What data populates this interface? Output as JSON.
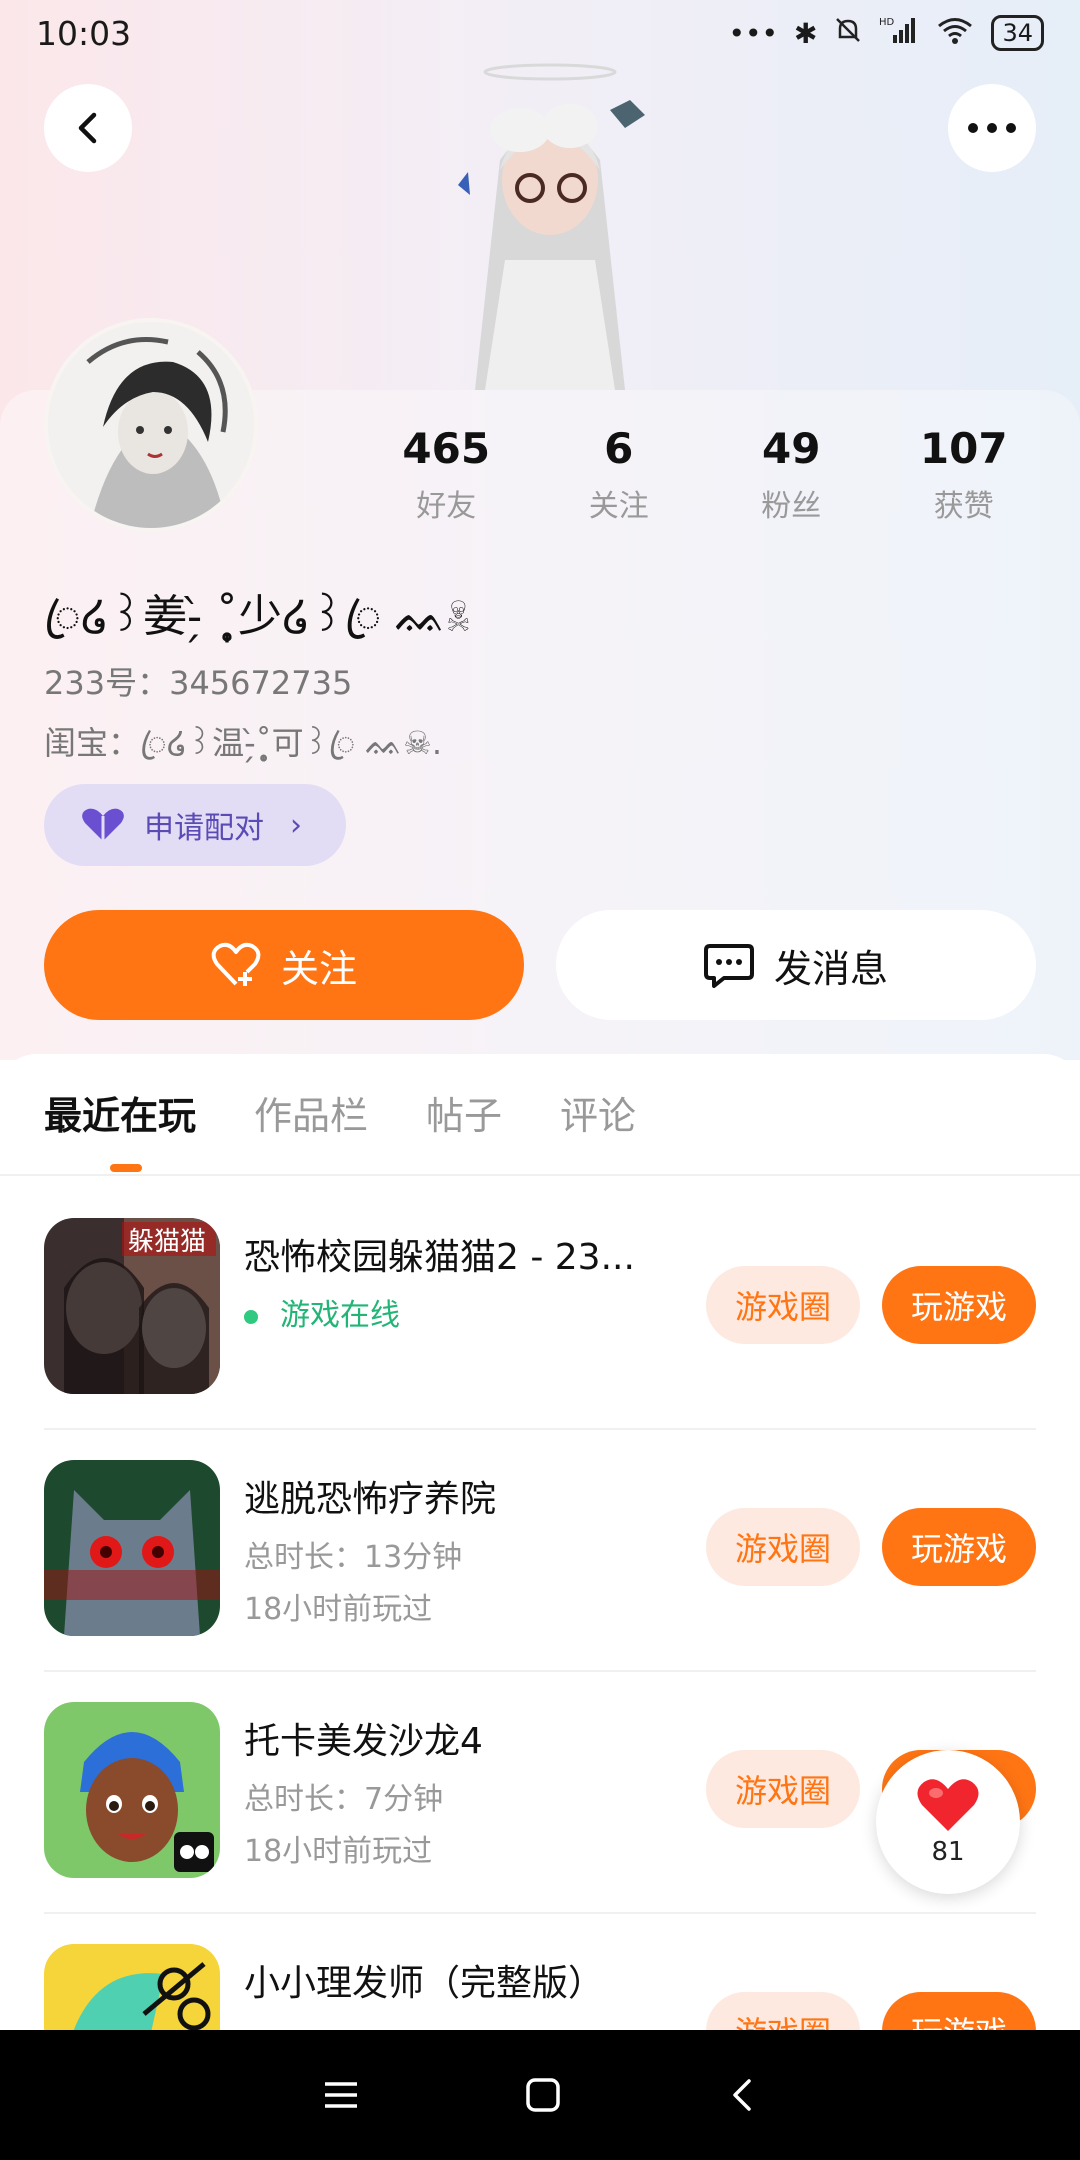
{
  "status_bar": {
    "time": "10:03",
    "battery": "34",
    "network": "HD"
  },
  "header": {
    "back_icon": "chevron-left-icon",
    "more_icon": "more-dots-icon"
  },
  "profile": {
    "stats": [
      {
        "value": "465",
        "label": "好友"
      },
      {
        "value": "6",
        "label": "关注"
      },
      {
        "value": "49",
        "label": "粉丝"
      },
      {
        "value": "107",
        "label": "获赞"
      }
    ],
    "username": "ꦿ໒꒱姜-̗̀ ˚̩̥̩̥少໒꒱ꦿ ᨐ☠",
    "uid": "233号：345672735",
    "bestie": "闺宝：ꦿ໒꒱温-̗̀˚̩̥̩̥可꒱ꦿ ᨐ☠.",
    "pair_button": "申请配对",
    "follow_button": "关注",
    "message_button": "发消息"
  },
  "tabs": [
    {
      "label": "最近在玩",
      "active": true
    },
    {
      "label": "作品栏",
      "active": false
    },
    {
      "label": "帖子",
      "active": false
    },
    {
      "label": "评论",
      "active": false
    }
  ],
  "games": [
    {
      "title": "恐怖校园躲猫猫2 - 23...",
      "line1": "游戏在线",
      "line2": "",
      "online": true,
      "icon_text": "躲猫猫"
    },
    {
      "title": "逃脱恐怖疗养院",
      "line1": "总时长：13分钟",
      "line2": "18小时前玩过",
      "online": false,
      "icon_text": ""
    },
    {
      "title": "托卡美发沙龙4",
      "line1": "总时长：7分钟",
      "line2": "18小时前玩过",
      "online": false,
      "icon_text": ""
    },
    {
      "title": "小小理发师（完整版）",
      "line1": "",
      "line2": "",
      "online": false,
      "icon_text": ""
    }
  ],
  "game_buttons": {
    "circle": "游戏圈",
    "play": "玩游戏"
  },
  "like_float": {
    "count": "81"
  },
  "colors": {
    "accent": "#ff7514",
    "pair_bg": "#e3dcf5",
    "online": "#22b576"
  }
}
